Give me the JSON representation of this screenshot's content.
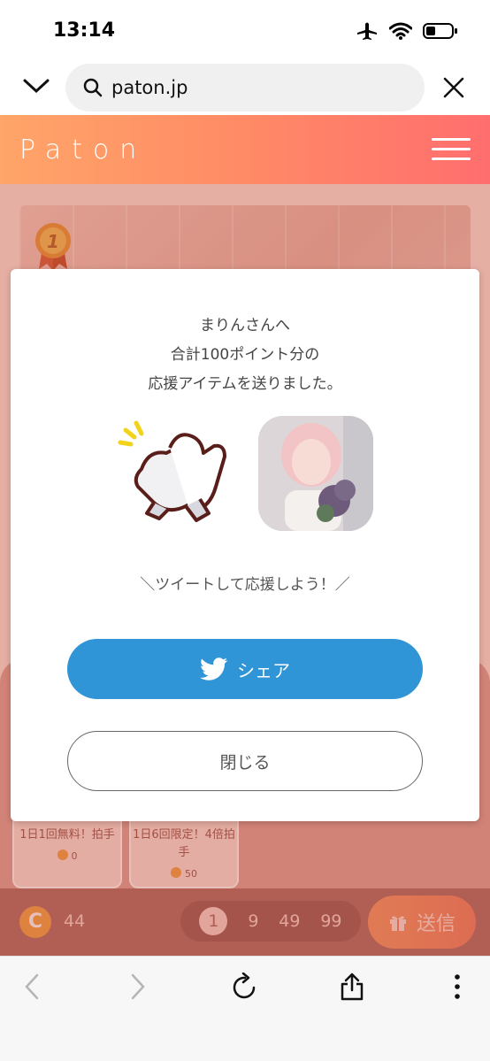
{
  "status_bar": {
    "time": "13:14"
  },
  "browser": {
    "url": "paton.jp"
  },
  "site": {
    "logo": "Paton"
  },
  "hero": {
    "rank": "1"
  },
  "modal": {
    "line1": "まりんさんへ",
    "line2": "合計100ポイント分の",
    "line3": "応援アイテムを送りました。",
    "tweet_prompt": "＼ツイートして応援しよう！／",
    "share_label": "シェア",
    "close_label": "閉じる"
  },
  "gift_cards": [
    {
      "label": "1日1回無料！拍手",
      "cost": "0"
    },
    {
      "label": "1日6回限定！4倍拍手",
      "cost": "50"
    }
  ],
  "bottom_bar": {
    "coin_symbol": "C",
    "coin_count": "44",
    "amounts": [
      "1",
      "9",
      "49",
      "99"
    ],
    "selected_amount": "1",
    "send_label": "送信"
  },
  "colors": {
    "brand_gradient_start": "#ffa568",
    "brand_gradient_end": "#ff6e6e",
    "twitter_blue": "#2f95d7"
  }
}
